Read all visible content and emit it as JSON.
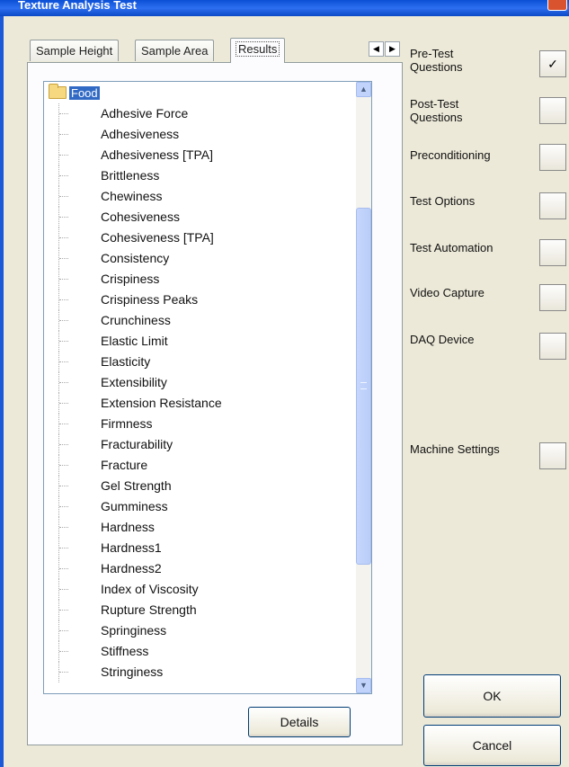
{
  "window": {
    "title": "Texture Analysis Test"
  },
  "tabs": [
    {
      "label": "Sample Height"
    },
    {
      "label": "Sample Area"
    },
    {
      "label": "Results"
    }
  ],
  "tree": {
    "root": "Food",
    "items": [
      "Adhesive Force",
      "Adhesiveness",
      "Adhesiveness [TPA]",
      "Brittleness",
      "Chewiness",
      "Cohesiveness",
      "Cohesiveness [TPA]",
      "Consistency",
      "Crispiness",
      "Crispiness Peaks",
      "Crunchiness",
      "Elastic Limit",
      "Elasticity",
      "Extensibility",
      "Extension Resistance",
      "Firmness",
      "Fracturability",
      "Fracture",
      "Gel Strength",
      "Gumminess",
      "Hardness",
      "Hardness1",
      "Hardness2",
      "Index of Viscosity",
      "Rupture Strength",
      "Springiness",
      "Stiffness",
      "Stringiness"
    ]
  },
  "buttons": {
    "details": "Details",
    "ok": "OK",
    "cancel": "Cancel"
  },
  "side_options": [
    {
      "label": "Pre-Test\nQuestions",
      "checked": true,
      "mark": "✓"
    },
    {
      "label": "Post-Test\nQuestions",
      "checked": false,
      "mark": ""
    },
    {
      "label": "Preconditioning",
      "checked": false,
      "mark": ""
    },
    {
      "label": "Test Options",
      "checked": false,
      "mark": ""
    },
    {
      "label": "Test Automation",
      "checked": false,
      "mark": ""
    },
    {
      "label": "Video Capture",
      "checked": false,
      "mark": ""
    },
    {
      "label": "DAQ Device",
      "checked": false,
      "mark": ""
    },
    {
      "label": "Machine Settings",
      "checked": false,
      "mark": ""
    }
  ]
}
